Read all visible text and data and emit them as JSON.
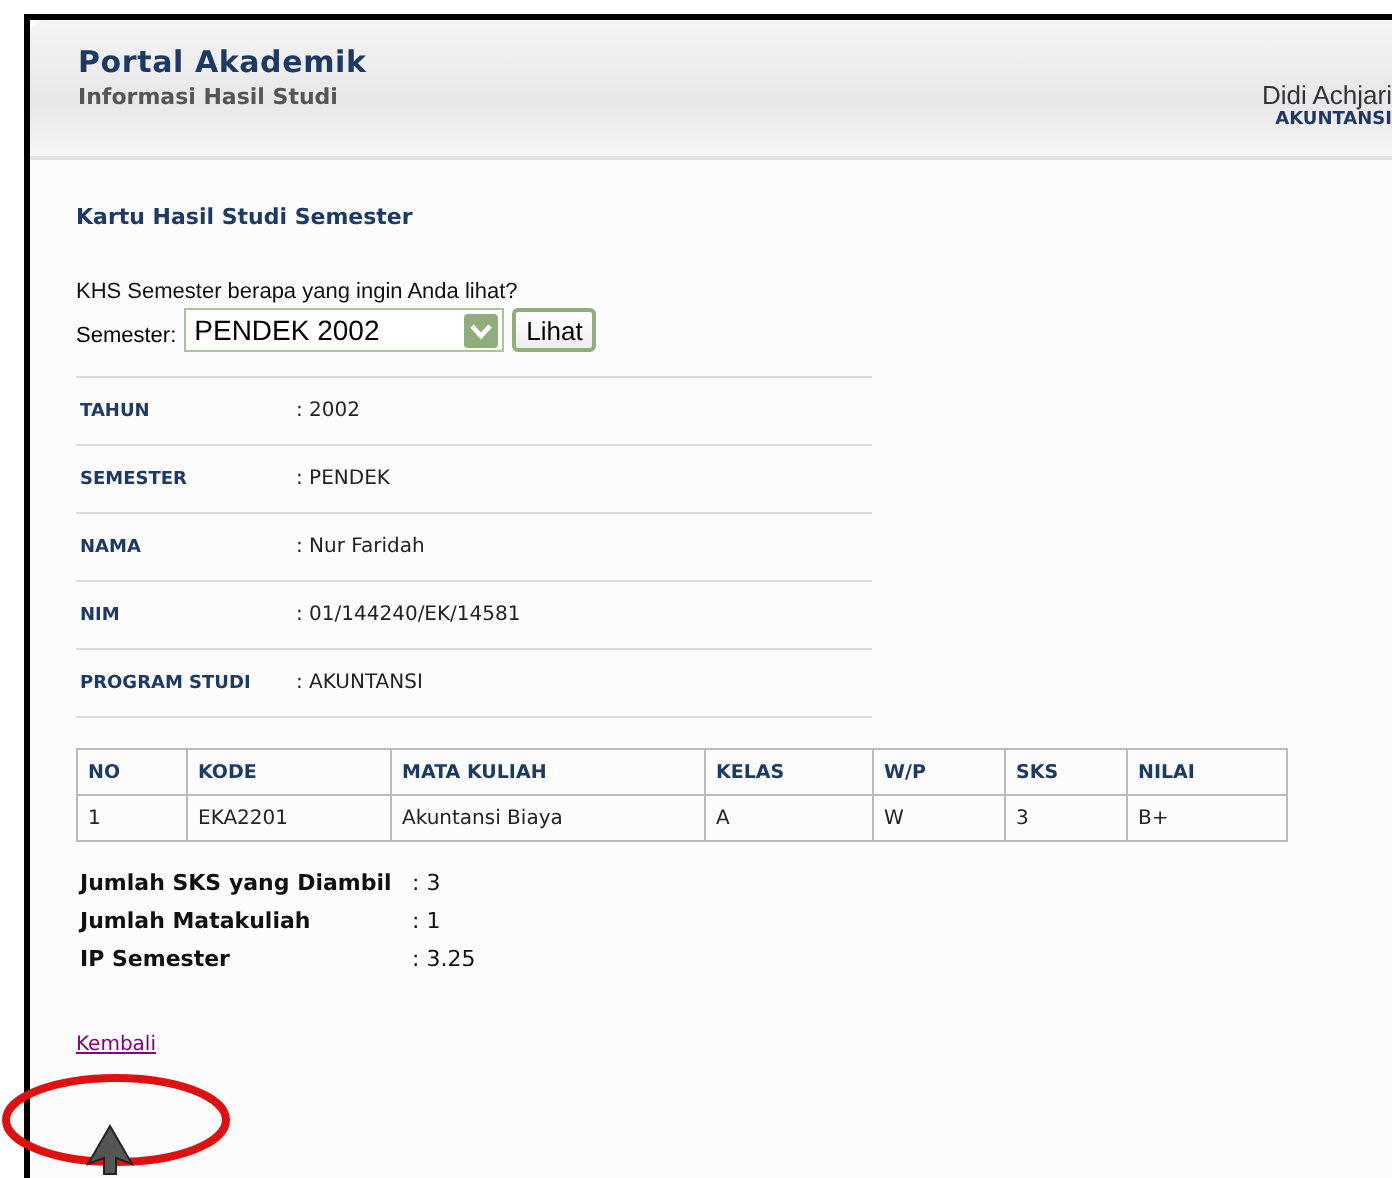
{
  "header": {
    "title": "Portal Akademik",
    "subtitle": "Informasi Hasil Studi",
    "user_name": "Didi Achjari",
    "user_program": "AKUNTANSI"
  },
  "page_title": "Kartu Hasil Studi Semester",
  "question": "KHS Semester berapa yang ingin Anda lihat?",
  "semester_field": {
    "label": "Semester:",
    "value": "PENDEK 2002"
  },
  "view_button": "Lihat",
  "info": [
    {
      "label": "TAHUN",
      "value": ": 2002"
    },
    {
      "label": "SEMESTER",
      "value": ": PENDEK"
    },
    {
      "label": "NAMA",
      "value": ": Nur Faridah"
    },
    {
      "label": "NIM",
      "value": ": 01/144240/EK/14581"
    },
    {
      "label": "PROGRAM STUDI",
      "value": ": AKUNTANSI"
    }
  ],
  "table": {
    "columns": [
      "NO",
      "KODE",
      "MATA KULIAH",
      "KELAS",
      "W/P",
      "SKS",
      "NILAI"
    ],
    "rows": [
      [
        "1",
        "EKA2201",
        "Akuntansi Biaya",
        "A",
        "W",
        "3",
        "B+"
      ]
    ]
  },
  "summary": [
    {
      "label": "Jumlah SKS yang Diambil",
      "value": ": 3"
    },
    {
      "label": "Jumlah Matakuliah",
      "value": ": 1"
    },
    {
      "label": "IP Semester",
      "value": ": 3.25"
    }
  ],
  "back_link": "Kembali"
}
